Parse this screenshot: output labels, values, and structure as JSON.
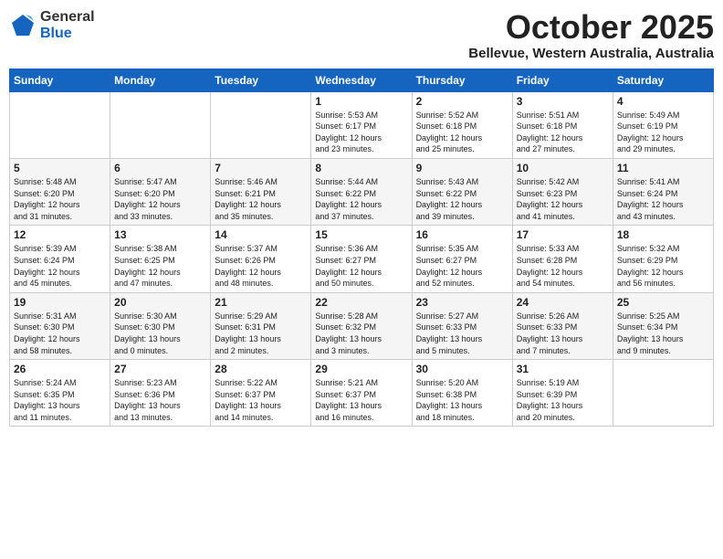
{
  "header": {
    "logo": {
      "general": "General",
      "blue": "Blue"
    },
    "title": "October 2025",
    "location": "Bellevue, Western Australia, Australia"
  },
  "days_of_week": [
    "Sunday",
    "Monday",
    "Tuesday",
    "Wednesday",
    "Thursday",
    "Friday",
    "Saturday"
  ],
  "weeks": [
    [
      {
        "day": "",
        "content": ""
      },
      {
        "day": "",
        "content": ""
      },
      {
        "day": "",
        "content": ""
      },
      {
        "day": "1",
        "content": "Sunrise: 5:53 AM\nSunset: 6:17 PM\nDaylight: 12 hours\nand 23 minutes."
      },
      {
        "day": "2",
        "content": "Sunrise: 5:52 AM\nSunset: 6:18 PM\nDaylight: 12 hours\nand 25 minutes."
      },
      {
        "day": "3",
        "content": "Sunrise: 5:51 AM\nSunset: 6:18 PM\nDaylight: 12 hours\nand 27 minutes."
      },
      {
        "day": "4",
        "content": "Sunrise: 5:49 AM\nSunset: 6:19 PM\nDaylight: 12 hours\nand 29 minutes."
      }
    ],
    [
      {
        "day": "5",
        "content": "Sunrise: 5:48 AM\nSunset: 6:20 PM\nDaylight: 12 hours\nand 31 minutes."
      },
      {
        "day": "6",
        "content": "Sunrise: 5:47 AM\nSunset: 6:20 PM\nDaylight: 12 hours\nand 33 minutes."
      },
      {
        "day": "7",
        "content": "Sunrise: 5:46 AM\nSunset: 6:21 PM\nDaylight: 12 hours\nand 35 minutes."
      },
      {
        "day": "8",
        "content": "Sunrise: 5:44 AM\nSunset: 6:22 PM\nDaylight: 12 hours\nand 37 minutes."
      },
      {
        "day": "9",
        "content": "Sunrise: 5:43 AM\nSunset: 6:22 PM\nDaylight: 12 hours\nand 39 minutes."
      },
      {
        "day": "10",
        "content": "Sunrise: 5:42 AM\nSunset: 6:23 PM\nDaylight: 12 hours\nand 41 minutes."
      },
      {
        "day": "11",
        "content": "Sunrise: 5:41 AM\nSunset: 6:24 PM\nDaylight: 12 hours\nand 43 minutes."
      }
    ],
    [
      {
        "day": "12",
        "content": "Sunrise: 5:39 AM\nSunset: 6:24 PM\nDaylight: 12 hours\nand 45 minutes."
      },
      {
        "day": "13",
        "content": "Sunrise: 5:38 AM\nSunset: 6:25 PM\nDaylight: 12 hours\nand 47 minutes."
      },
      {
        "day": "14",
        "content": "Sunrise: 5:37 AM\nSunset: 6:26 PM\nDaylight: 12 hours\nand 48 minutes."
      },
      {
        "day": "15",
        "content": "Sunrise: 5:36 AM\nSunset: 6:27 PM\nDaylight: 12 hours\nand 50 minutes."
      },
      {
        "day": "16",
        "content": "Sunrise: 5:35 AM\nSunset: 6:27 PM\nDaylight: 12 hours\nand 52 minutes."
      },
      {
        "day": "17",
        "content": "Sunrise: 5:33 AM\nSunset: 6:28 PM\nDaylight: 12 hours\nand 54 minutes."
      },
      {
        "day": "18",
        "content": "Sunrise: 5:32 AM\nSunset: 6:29 PM\nDaylight: 12 hours\nand 56 minutes."
      }
    ],
    [
      {
        "day": "19",
        "content": "Sunrise: 5:31 AM\nSunset: 6:30 PM\nDaylight: 12 hours\nand 58 minutes."
      },
      {
        "day": "20",
        "content": "Sunrise: 5:30 AM\nSunset: 6:30 PM\nDaylight: 13 hours\nand 0 minutes."
      },
      {
        "day": "21",
        "content": "Sunrise: 5:29 AM\nSunset: 6:31 PM\nDaylight: 13 hours\nand 2 minutes."
      },
      {
        "day": "22",
        "content": "Sunrise: 5:28 AM\nSunset: 6:32 PM\nDaylight: 13 hours\nand 3 minutes."
      },
      {
        "day": "23",
        "content": "Sunrise: 5:27 AM\nSunset: 6:33 PM\nDaylight: 13 hours\nand 5 minutes."
      },
      {
        "day": "24",
        "content": "Sunrise: 5:26 AM\nSunset: 6:33 PM\nDaylight: 13 hours\nand 7 minutes."
      },
      {
        "day": "25",
        "content": "Sunrise: 5:25 AM\nSunset: 6:34 PM\nDaylight: 13 hours\nand 9 minutes."
      }
    ],
    [
      {
        "day": "26",
        "content": "Sunrise: 5:24 AM\nSunset: 6:35 PM\nDaylight: 13 hours\nand 11 minutes."
      },
      {
        "day": "27",
        "content": "Sunrise: 5:23 AM\nSunset: 6:36 PM\nDaylight: 13 hours\nand 13 minutes."
      },
      {
        "day": "28",
        "content": "Sunrise: 5:22 AM\nSunset: 6:37 PM\nDaylight: 13 hours\nand 14 minutes."
      },
      {
        "day": "29",
        "content": "Sunrise: 5:21 AM\nSunset: 6:37 PM\nDaylight: 13 hours\nand 16 minutes."
      },
      {
        "day": "30",
        "content": "Sunrise: 5:20 AM\nSunset: 6:38 PM\nDaylight: 13 hours\nand 18 minutes."
      },
      {
        "day": "31",
        "content": "Sunrise: 5:19 AM\nSunset: 6:39 PM\nDaylight: 13 hours\nand 20 minutes."
      },
      {
        "day": "",
        "content": ""
      }
    ]
  ]
}
